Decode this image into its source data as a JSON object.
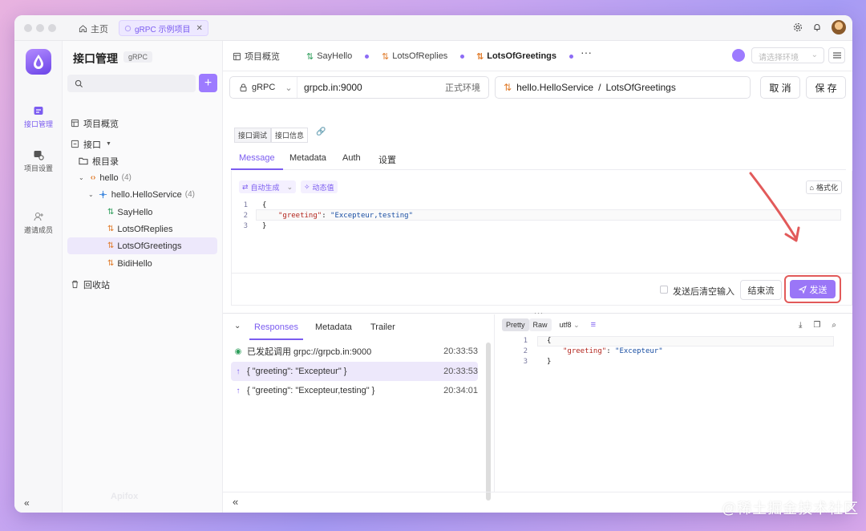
{
  "titlebar": {
    "home_label": "主页",
    "project_tab": "gRPC 示例项目"
  },
  "rail": {
    "items": [
      {
        "label": "接口管理",
        "icon": "api-icon"
      },
      {
        "label": "项目设置",
        "icon": "project-settings-icon"
      },
      {
        "label": "邀请成员",
        "icon": "invite-member-icon"
      }
    ]
  },
  "sidebar": {
    "title": "接口管理",
    "badge": "gRPC",
    "overview": "项目概览",
    "interfaces": "接口",
    "root_folder": "根目录",
    "hello_package": "hello",
    "hello_count": "(4)",
    "service": "hello.HelloService",
    "service_count": "(4)",
    "methods": [
      "SayHello",
      "LotsOfReplies",
      "LotsOfGreetings",
      "BidiHello"
    ],
    "recycle": "回收站",
    "footer": "Apifox"
  },
  "tabs": {
    "overview": "项目概览",
    "items": [
      "SayHello",
      "LotsOfReplies",
      "LotsOfGreetings"
    ],
    "env_placeholder": "请选择环境"
  },
  "request": {
    "protocol": "gRPC",
    "host": "grpcb.in:9000",
    "env": "正式环境",
    "service_path": "hello.HelloService",
    "method": "LotsOfGreetings",
    "cancel": "取 消",
    "save": "保 存",
    "subtabs": [
      "接口调试",
      "接口信息"
    ],
    "msgtabs": [
      "Message",
      "Metadata",
      "Auth",
      "设置"
    ],
    "auto_gen": "自动生成",
    "dynamic": "动态值",
    "format": "格式化",
    "code_lines": [
      "{",
      "\"greeting\"",
      ": ",
      "\"Excepteur,testing\"",
      "}"
    ],
    "clear_after_send": "发送后清空输入",
    "end_stream": "结束流",
    "send": "发送"
  },
  "response": {
    "tabs": [
      "Responses",
      "Metadata",
      "Trailer"
    ],
    "rows": [
      {
        "text": "已发起调用 grpc://grpcb.in:9000",
        "time": "20:33:53"
      },
      {
        "text": "{ \"greeting\": \"Excepteur\" }",
        "time": "20:33:53"
      },
      {
        "text": "{ \"greeting\": \"Excepteur,testing\" }",
        "time": "20:34:01"
      }
    ],
    "view_modes": [
      "Pretty",
      "Raw"
    ],
    "encoding": "utf8",
    "code_key": "\"greeting\"",
    "code_val": "\"Excepteur\""
  },
  "watermark": "@稀土掘金技术社区",
  "colors": {
    "accent": "#7b5cf0",
    "highlight_box": "#e25a5a"
  }
}
